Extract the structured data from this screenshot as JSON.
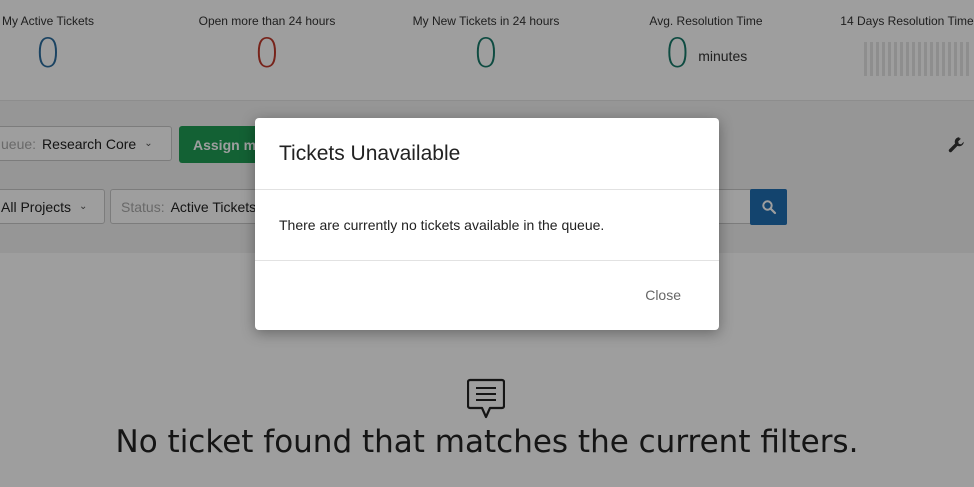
{
  "stats": [
    {
      "label": "My Active Tickets",
      "value": "0",
      "color": "#2b6c9e"
    },
    {
      "label": "Open more than 24 hours",
      "value": "0",
      "color": "#c0392b"
    },
    {
      "label": "My New Tickets in 24 hours",
      "value": "0",
      "color": "#177a6a"
    },
    {
      "label": "Avg. Resolution Time",
      "value": "0",
      "unit": "minutes",
      "color": "#177a6a"
    },
    {
      "label": "14 Days Resolution Time"
    }
  ],
  "filters": {
    "queue_label": "ueue:",
    "queue_value": "Research Core",
    "assign_button": "Assign me",
    "projects_value": "All Projects",
    "status_label": "Status:",
    "status_value": "Active Tickets"
  },
  "icons": {
    "search": "search-icon",
    "wrench": "wrench-icon",
    "empty": "chat-bubble-icon"
  },
  "empty_state": {
    "text": "No ticket found that matches the current filters."
  },
  "modal": {
    "title": "Tickets Unavailable",
    "message": "There are currently no tickets available in the queue.",
    "close_label": "Close"
  },
  "colors": {
    "primary_button": "#1f9d55",
    "search_button": "#1f6fb2",
    "overlay": "rgba(0,0,0,0.38)"
  }
}
